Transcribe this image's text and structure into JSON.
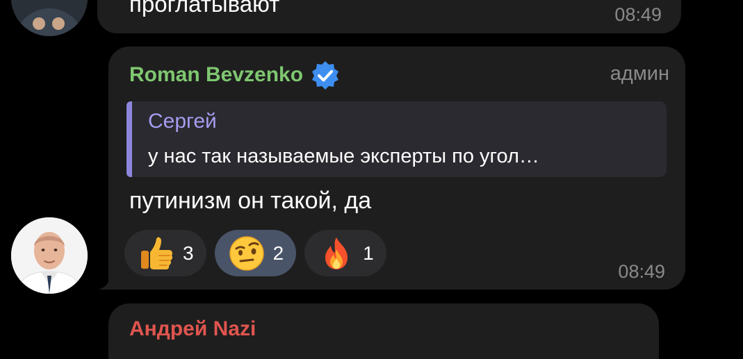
{
  "previous_message": {
    "text": "проглатывают",
    "time": "08:49"
  },
  "message": {
    "sender": "Roman Bevzenko",
    "sender_verified": true,
    "role_badge": "админ",
    "reply": {
      "author": "Сергей",
      "text": "у нас так называемые эксперты по угол…"
    },
    "text": "путинизм он такой, да",
    "reactions": [
      {
        "emoji": "thumbs-up-icon",
        "count": "3",
        "selected": false
      },
      {
        "emoji": "raised-eyebrow-face-icon",
        "count": "2",
        "selected": true
      },
      {
        "emoji": "fire-icon",
        "count": "1",
        "selected": false
      }
    ],
    "time": "08:49"
  },
  "next_message": {
    "sender": "Андрей Nazi"
  },
  "colors": {
    "background": "#000000",
    "bubble": "#1e1e1e",
    "sender_name": "#7fc770",
    "reply_accent": "#8e86dd",
    "reply_author": "#a59df0",
    "reaction_selected": "#4a5468",
    "reaction_default": "#2c2c2e",
    "verified_badge": "#3d8ef0",
    "next_sender": "#e0554f"
  }
}
